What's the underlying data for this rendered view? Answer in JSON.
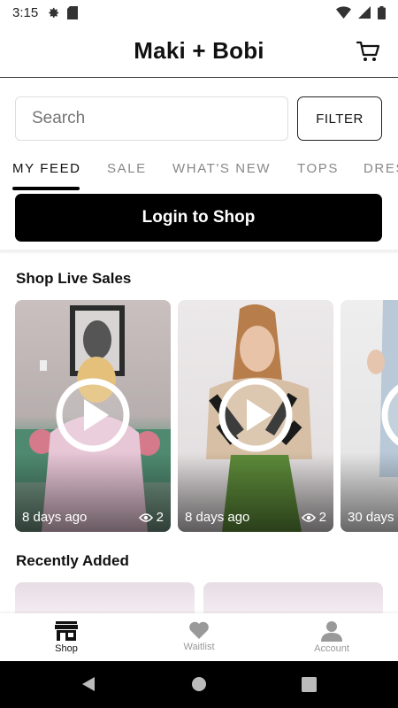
{
  "status_bar": {
    "time": "3:15",
    "left_icons": [
      "gear-icon",
      "sim-card-icon"
    ],
    "right_icons": [
      "wifi-icon",
      "signal-icon",
      "battery-icon"
    ]
  },
  "header": {
    "title": "Maki + Bobi",
    "cart_icon": "cart-icon"
  },
  "search": {
    "placeholder": "Search",
    "filter_label": "FILTER"
  },
  "tabs": [
    {
      "label": "MY FEED",
      "active": true
    },
    {
      "label": "SALE",
      "active": false
    },
    {
      "label": "WHAT'S NEW",
      "active": false
    },
    {
      "label": "TOPS",
      "active": false
    },
    {
      "label": "DRES",
      "active": false
    }
  ],
  "login_button": "Login to Shop",
  "live_sales": {
    "title": "Shop Live Sales",
    "cards": [
      {
        "ago": "8 days ago",
        "views": "2"
      },
      {
        "ago": "8 days ago",
        "views": "2"
      },
      {
        "ago": "30 days",
        "views": ""
      }
    ]
  },
  "recently_added": {
    "title": "Recently Added"
  },
  "bottom_nav": [
    {
      "label": "Shop",
      "icon": "storefront-icon",
      "active": true
    },
    {
      "label": "Waitlist",
      "icon": "heart-icon",
      "active": false
    },
    {
      "label": "Account",
      "icon": "person-icon",
      "active": false
    }
  ],
  "system_nav": [
    "back-icon",
    "home-icon",
    "recents-icon"
  ],
  "colors": {
    "accent": "#000000",
    "muted": "#888888"
  }
}
